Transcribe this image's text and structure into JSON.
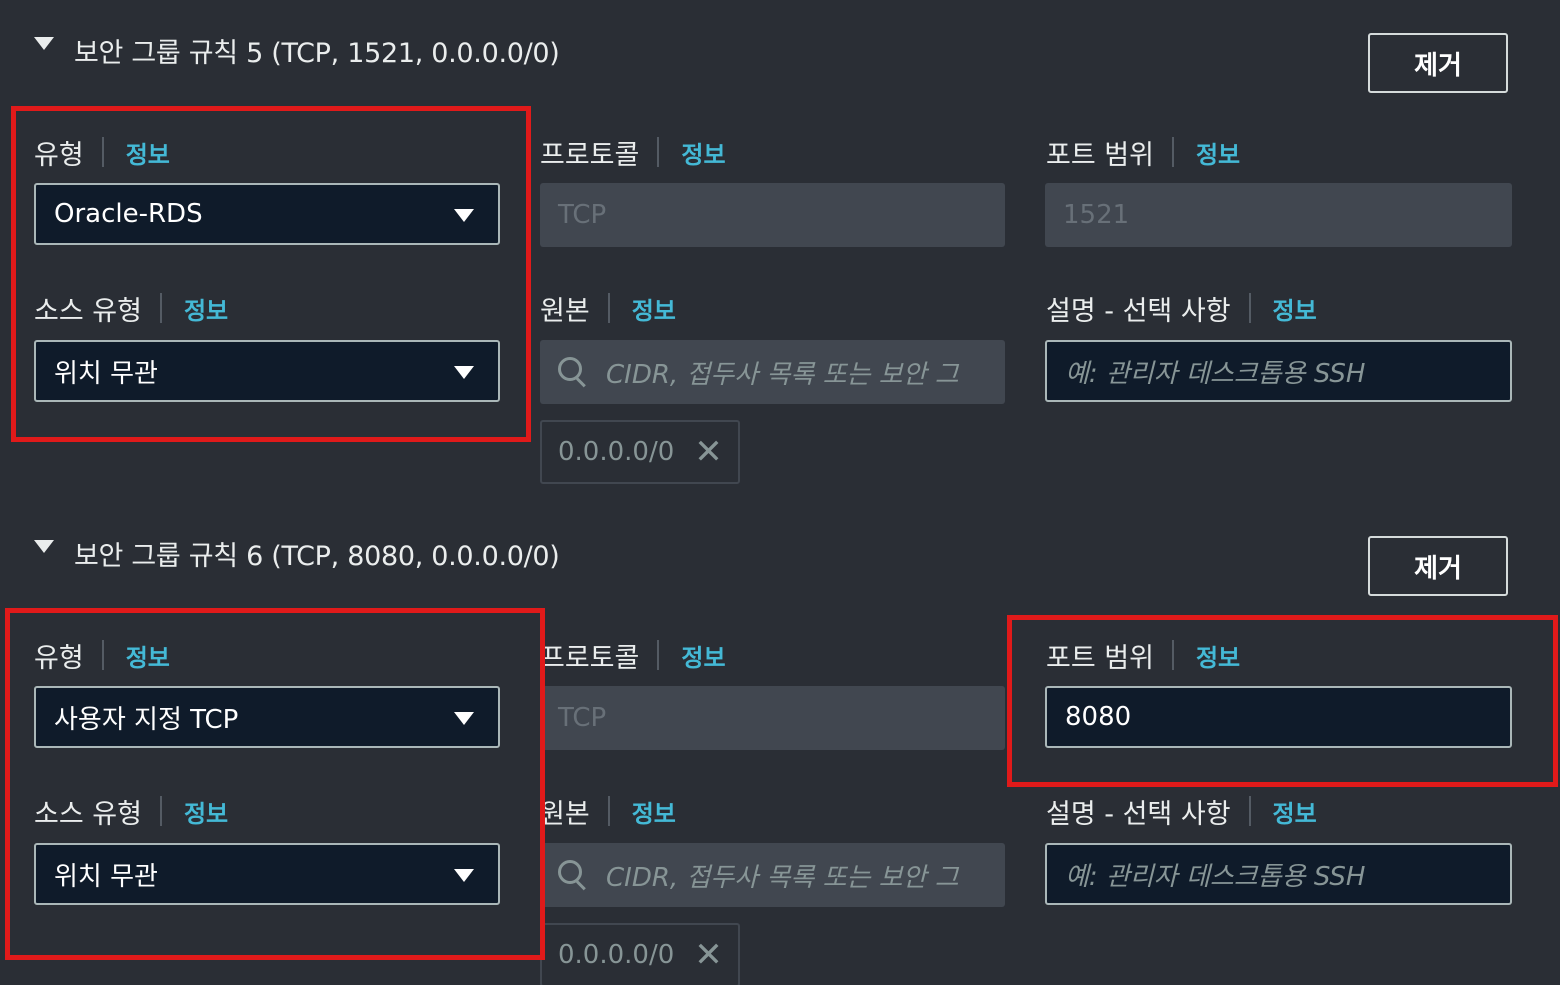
{
  "info_label": "정보",
  "rules": [
    {
      "title": "보안 그룹 규칙 5 (TCP, 1521, 0.0.0.0/0)",
      "remove_label": "제거",
      "type_label": "유형",
      "type_value": "Oracle-RDS",
      "protocol_label": "프로토콜",
      "protocol_value": "TCP",
      "port_range_label": "포트 범위",
      "port_range_value": "1521",
      "source_type_label": "소스 유형",
      "source_type_value": "위치 무관",
      "source_label": "원본",
      "source_search_placeholder": "CIDR, 접두사 목록 또는 보안 그",
      "source_token": "0.0.0.0/0",
      "description_label": "설명 - 선택 사항",
      "description_placeholder": "예: 관리자 데스크톱용 SSH"
    },
    {
      "title": "보안 그룹 규칙 6 (TCP, 8080, 0.0.0.0/0)",
      "remove_label": "제거",
      "type_label": "유형",
      "type_value": "사용자 지정 TCP",
      "protocol_label": "프로토콜",
      "protocol_value": "TCP",
      "port_range_label": "포트 범위",
      "port_range_value": "8080",
      "source_type_label": "소스 유형",
      "source_type_value": "위치 무관",
      "source_label": "원본",
      "source_search_placeholder": "CIDR, 접두사 목록 또는 보안 그",
      "source_token": "0.0.0.0/0",
      "description_label": "설명 - 선택 사항",
      "description_placeholder": "예: 관리자 데스크톱용 SSH"
    }
  ],
  "colors": {
    "background": "#2a2e35",
    "info_link": "#44b9d6",
    "highlight": "#e01a1a",
    "input_bg": "#0f1b2a",
    "disabled_bg": "#414750"
  }
}
